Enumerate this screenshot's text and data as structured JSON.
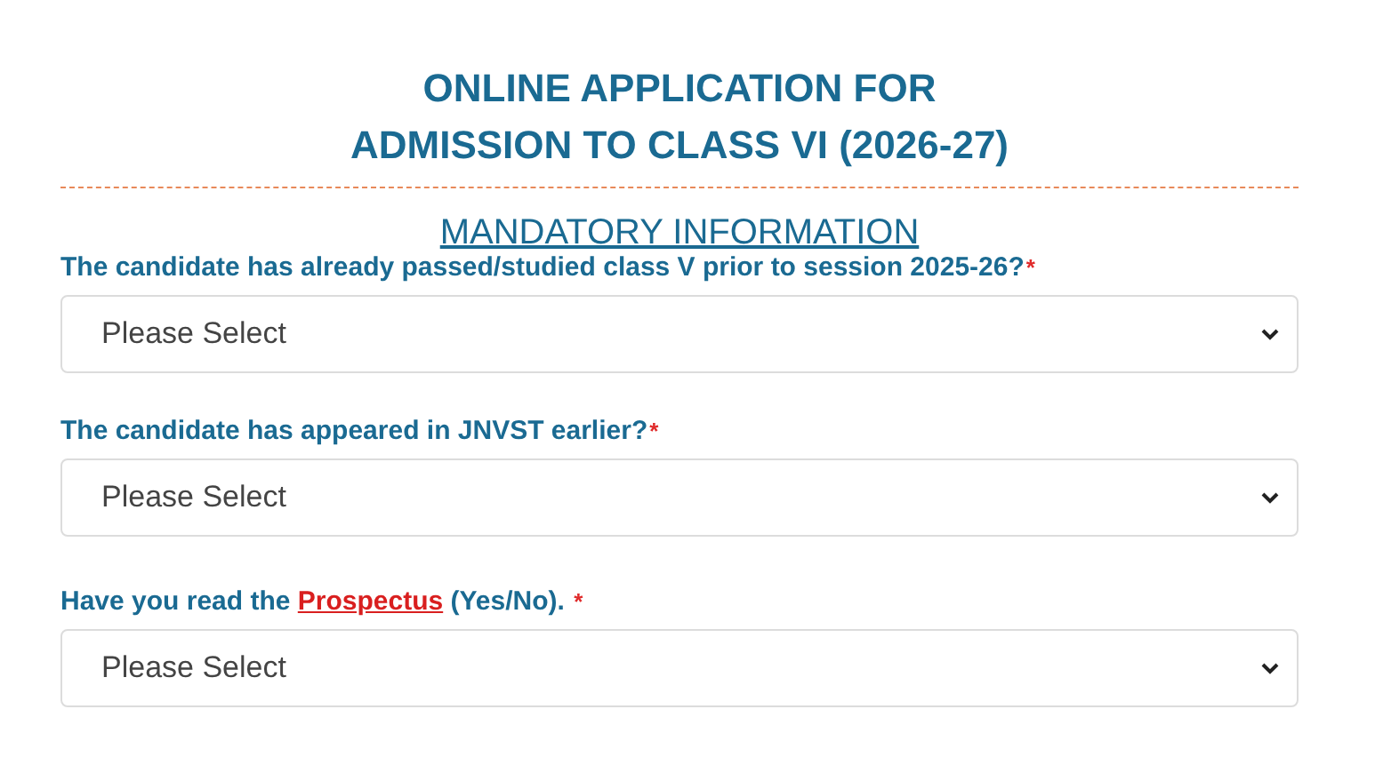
{
  "title_lines": [
    "ONLINE APPLICATION FOR",
    "ADMISSION TO CLASS VI (2026-27)"
  ],
  "section_heading": "MANDATORY INFORMATION",
  "questions": [
    {
      "label": "The candidate has already passed/studied class V prior to session 2025-26?",
      "required_mark": "*",
      "value": "Please Select"
    },
    {
      "label": "The candidate has appeared in JNVST earlier?",
      "required_mark": "*",
      "value": "Please Select"
    },
    {
      "label": "Have you read the ",
      "link": "Prospectus",
      "label_after": " (Yes/No). ",
      "required_mark": "*",
      "value": "Please Select"
    }
  ]
}
